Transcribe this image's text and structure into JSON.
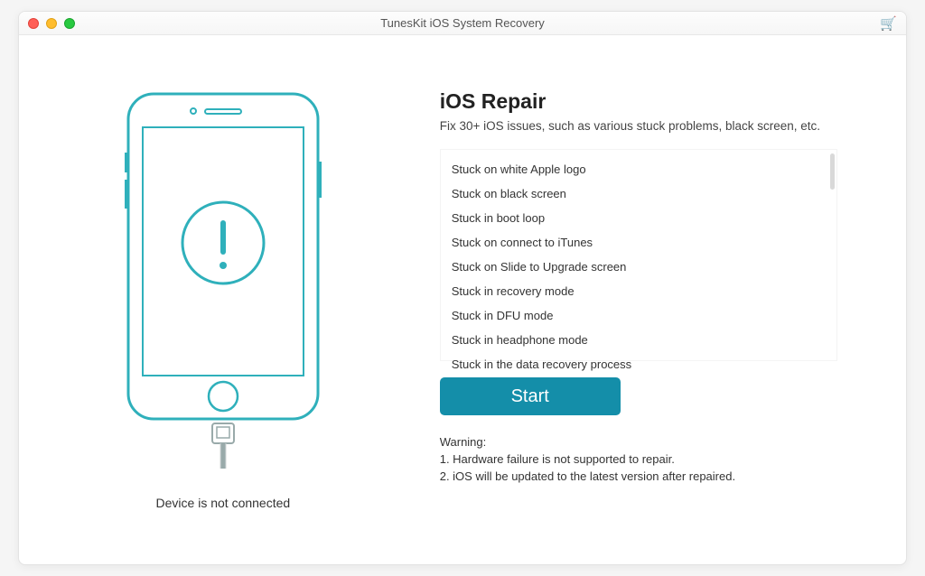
{
  "window": {
    "title": "TunesKit iOS System Recovery"
  },
  "left_panel": {
    "status": "Device is not connected"
  },
  "repair": {
    "heading": "iOS Repair",
    "subtitle": "Fix 30+ iOS issues, such as various stuck problems, black screen, etc.",
    "issues": [
      "Stuck on white Apple logo",
      "Stuck on black screen",
      "Stuck in boot loop",
      "Stuck on connect to iTunes",
      "Stuck on Slide to Upgrade screen",
      "Stuck in recovery mode",
      "Stuck in DFU mode",
      "Stuck in headphone mode",
      "Stuck in the data recovery process"
    ],
    "start_label": "Start",
    "warning_heading": "Warning:",
    "warnings": [
      "1. Hardware failure is not supported to repair.",
      "2. iOS will be updated to the latest version after repaired."
    ]
  },
  "colors": {
    "accent": "#148ea9",
    "phone_stroke": "#2fb0bb"
  }
}
